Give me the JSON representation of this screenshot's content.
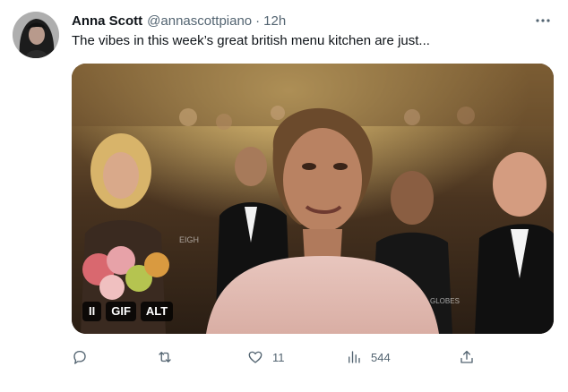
{
  "author": {
    "name": "Anna Scott",
    "handle": "@annascottpiano",
    "separator": "·",
    "time": "12h"
  },
  "tweet": {
    "text": "The vibes in this week’s great british menu kitchen are just..."
  },
  "media": {
    "controls": {
      "pause_label": "II",
      "gif_label": "GIF",
      "alt_label": "ALT"
    },
    "overlay_text": {
      "left_sign": "EIGH",
      "right_logo": "GLOBES"
    }
  },
  "actions": {
    "reply_count": "",
    "retweet_count": "",
    "like_count": "11",
    "views_count": "544",
    "share_count": ""
  },
  "icons": {
    "more": "more-horizontal-icon",
    "reply": "reply-bubble-icon",
    "retweet": "retweet-arrows-icon",
    "like": "heart-icon",
    "views": "views-bar-chart-icon",
    "share": "share-upload-icon"
  },
  "colors": {
    "text_primary": "#0f1419",
    "text_secondary": "#536471",
    "background": "#ffffff"
  }
}
